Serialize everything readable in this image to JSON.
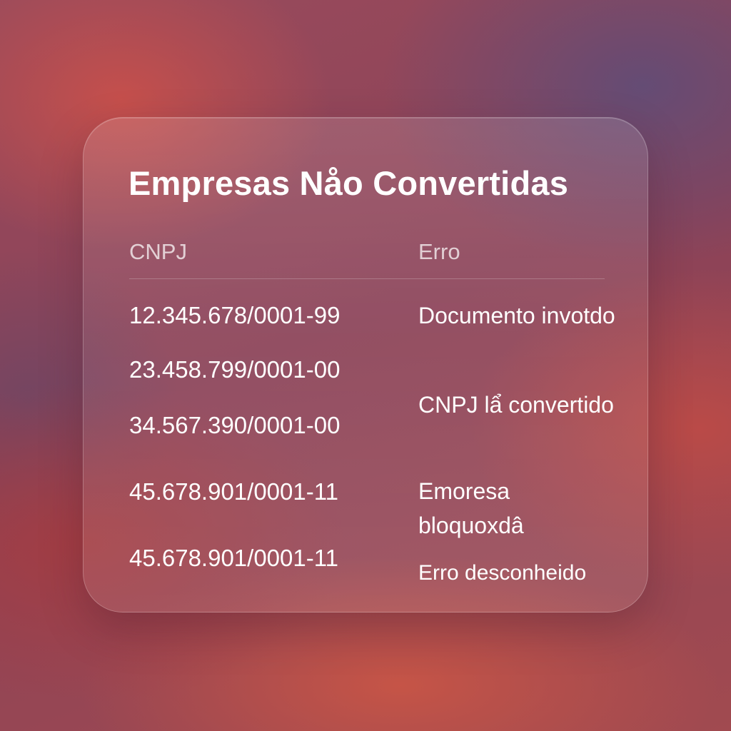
{
  "title": "Empresas Nåo Convertidas",
  "table": {
    "headers": {
      "cnpj": "CNPJ",
      "erro": "Erro"
    },
    "cnpj_values": [
      "12.345.678/0001-99",
      "23.458.799/0001-00",
      "34.567.390/0001-00",
      "45.678.901/0001-11",
      "45.678.901/0001-11"
    ],
    "erro_values": [
      "Documento invotdo",
      "CNPJ lẩ convertido",
      "Emoresa bloquoxdâ",
      "Erro desconheido"
    ]
  },
  "colors": {
    "card_text": "#ffffff",
    "header_text": "rgba(255,255,255,0.72)"
  }
}
